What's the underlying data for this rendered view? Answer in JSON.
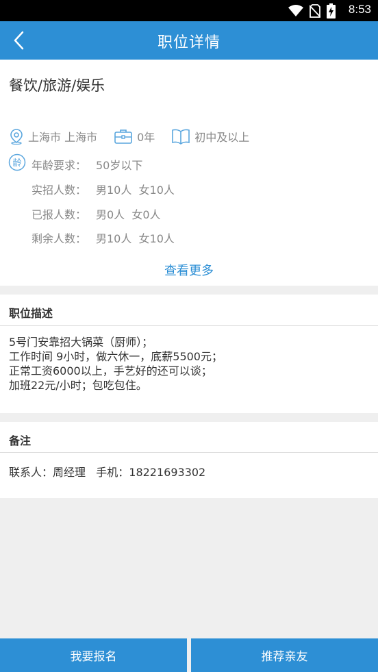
{
  "status_bar": {
    "time": "8:53",
    "icons": [
      "wifi-icon",
      "no-sim-icon",
      "battery-charging-icon"
    ]
  },
  "app_bar": {
    "title": "职位详情",
    "back_icon": "chevron-left-icon"
  },
  "job": {
    "category": "餐饮/旅游/娱乐",
    "location": "上海市 上海市",
    "experience": "0年",
    "education": "初中及以上",
    "requirements": [
      {
        "label": "年龄要求：",
        "value": "50岁以下"
      },
      {
        "label": "实招人数：",
        "value": "男10人  女10人"
      },
      {
        "label": "已报人数：",
        "value": "男0人  女0人"
      },
      {
        "label": "剩余人数：",
        "value": "男10人  女10人"
      }
    ],
    "age_icon_text": "龄",
    "see_more": "查看更多"
  },
  "description": {
    "title": "职位描述",
    "lines": [
      "5号门安靠招大锅菜（厨师）；",
      "工作时间 9小时，做六休一，底薪5500元；",
      "正常工资6000以上，手艺好的还可以谈；",
      "加班22元/小时；包吃包住。"
    ]
  },
  "remark": {
    "title": "备注",
    "content": "联系人：周经理   手机：18221693302"
  },
  "actions": {
    "apply": "我要报名",
    "recommend": "推荐亲友"
  },
  "colors": {
    "primary": "#2d8fd5",
    "text": "#333333",
    "muted": "#888888",
    "background": "#efefef"
  }
}
